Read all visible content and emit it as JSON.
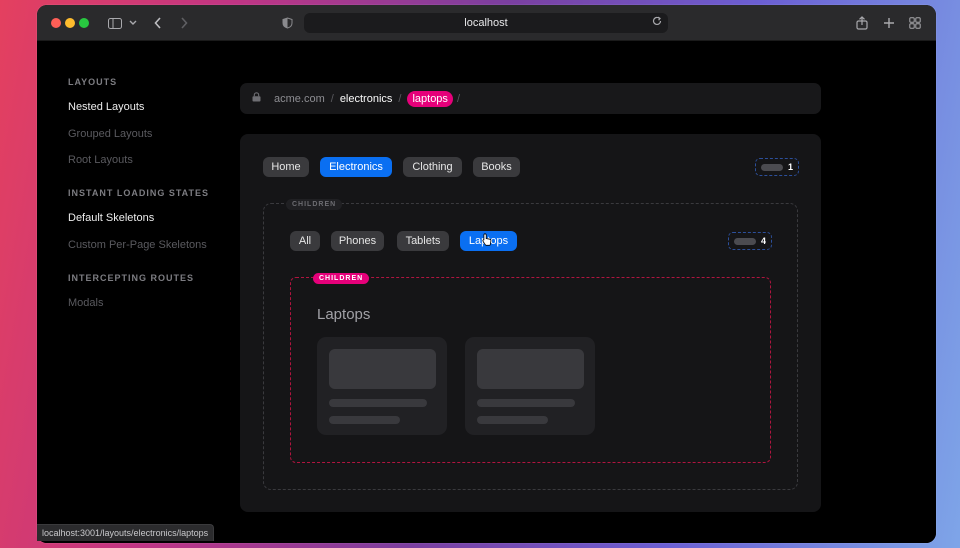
{
  "browser": {
    "url": "localhost",
    "status_url": "localhost:3001/layouts/electronics/laptops"
  },
  "sidebar": {
    "sections": [
      {
        "title": "LAYOUTS",
        "items": [
          {
            "label": "Nested Layouts",
            "active": true
          },
          {
            "label": "Grouped Layouts",
            "active": false
          },
          {
            "label": "Root Layouts",
            "active": false
          }
        ]
      },
      {
        "title": "INSTANT LOADING STATES",
        "items": [
          {
            "label": "Default Skeletons",
            "active": true
          },
          {
            "label": "Custom Per-Page Skeletons",
            "active": false
          }
        ]
      },
      {
        "title": "INTERCEPTING ROUTES",
        "items": [
          {
            "label": "Modals",
            "active": false
          }
        ]
      }
    ]
  },
  "breadcrumb": {
    "domain": "acme.com",
    "sep": "/",
    "segment1": "electronics",
    "segment2": "laptops"
  },
  "top_nav": {
    "tabs": [
      "Home",
      "Electronics",
      "Clothing",
      "Books"
    ],
    "active": "Electronics",
    "count": "1"
  },
  "children_label": "CHILDREN",
  "sub_nav": {
    "tabs": [
      "All",
      "Phones",
      "Tablets",
      "Laptops"
    ],
    "active": "Laptops",
    "count": "4"
  },
  "inner_children_label": "CHILDREN",
  "page": {
    "heading": "Laptops"
  },
  "colors": {
    "accent_blue": "#0a6ff2",
    "accent_pink": "#e6007a"
  }
}
